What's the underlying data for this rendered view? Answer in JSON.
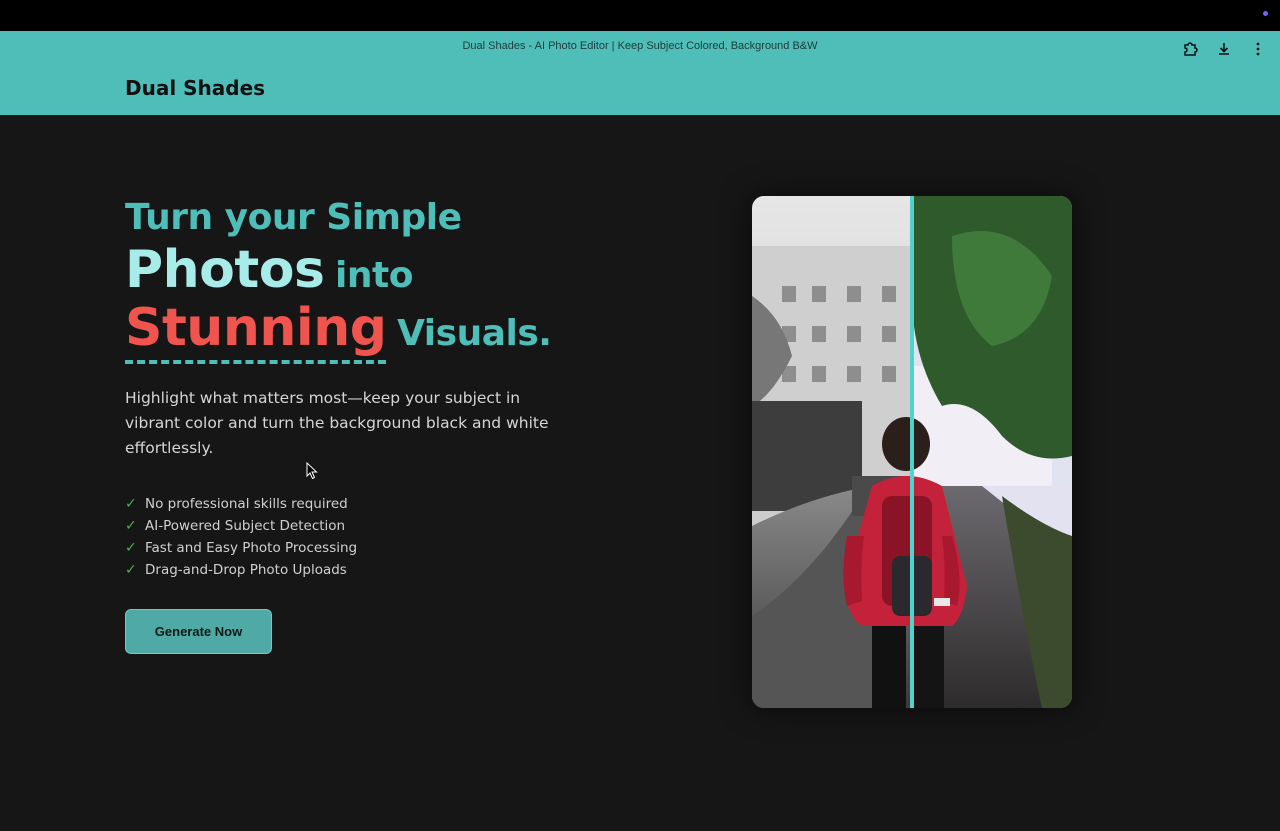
{
  "window": {
    "title": "Dual Shades - AI Photo Editor | Keep Subject Colored, Background B&W"
  },
  "browser_actions": [
    "extension-icon",
    "download-icon",
    "more-menu-icon"
  ],
  "site": {
    "brand": "Dual Shades"
  },
  "hero": {
    "line1": "Turn your Simple",
    "photos": "Photos",
    "into": "into",
    "stunning": "Stunning",
    "visuals": "Visuals.",
    "subtext": "Highlight what matters most—keep your subject in vibrant color and turn the background black and white effortlessly.",
    "features": [
      "No professional skills required",
      "AI-Powered Subject Detection",
      "Fast and Easy Photo Processing",
      "Drag-and-Drop Photo Uploads"
    ],
    "cta_label": "Generate Now"
  },
  "colors": {
    "accent": "#4fbdb8",
    "highlight": "#f0544f",
    "background": "#161616"
  }
}
